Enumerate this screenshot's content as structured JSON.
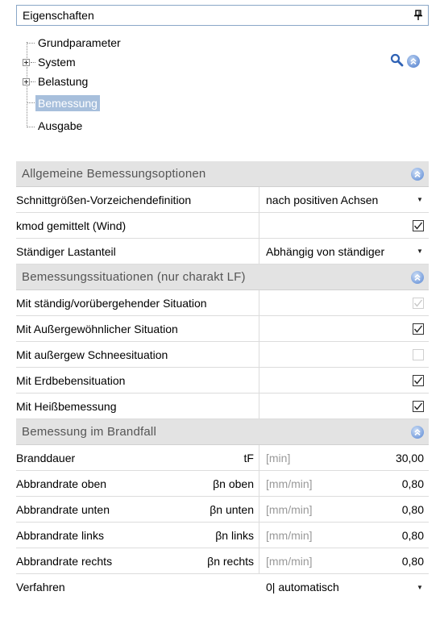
{
  "panel": {
    "title": "Eigenschaften",
    "pin_icon": "pin-icon"
  },
  "tree": {
    "items": [
      {
        "label": "Grundparameter",
        "expandable": false,
        "selected": false
      },
      {
        "label": "System",
        "expandable": true,
        "selected": false
      },
      {
        "label": "Belastung",
        "expandable": true,
        "selected": false
      },
      {
        "label": "Bemessung",
        "expandable": false,
        "selected": true
      },
      {
        "label": "Ausgabe",
        "expandable": false,
        "selected": false
      }
    ],
    "tools": {
      "search_icon": "search-icon",
      "collapse_icon": "collapse-all-icon"
    }
  },
  "colors": {
    "accent": "#6b93d6",
    "selection": "#a7bfdc",
    "category_bg": "#e3e3e3",
    "border": "#8aa7c7",
    "unit_gray": "#999999"
  },
  "grid": {
    "cat1": {
      "title": "Allgemeine Bemessungsoptionen",
      "rows": [
        {
          "name": "Schnittgrößen-Vorzeichendefinition",
          "value": "nach positiven Achsen"
        },
        {
          "name": "kmod gemittelt (Wind)",
          "checked": true
        },
        {
          "name": "Ständiger Lastanteil",
          "value": "Abhängig von ständiger"
        }
      ]
    },
    "cat2": {
      "title": "Bemessungssituationen (nur charakt LF)",
      "rows": [
        {
          "name": "Mit ständig/vorübergehender Situation",
          "checked": true,
          "disabled": true
        },
        {
          "name": "Mit Außergewöhnlicher Situation",
          "checked": true
        },
        {
          "name": "Mit außergew Schneesituation",
          "checked": false,
          "disabled": true
        },
        {
          "name": "Mit Erdbebensituation",
          "checked": true
        },
        {
          "name": "Mit Heißbemessung",
          "checked": true
        }
      ]
    },
    "cat3": {
      "title": "Bemessung im Brandfall",
      "rows": [
        {
          "name": "Branddauer",
          "symbol": "tF",
          "unit": "[min]",
          "value": "30,00"
        },
        {
          "name": "Abbrandrate oben",
          "symbol": "βn oben",
          "unit": "[mm/min]",
          "value": "0,80"
        },
        {
          "name": "Abbrandrate unten",
          "symbol": "βn unten",
          "unit": "[mm/min]",
          "value": "0,80"
        },
        {
          "name": "Abbrandrate links",
          "symbol": "βn links",
          "unit": "[mm/min]",
          "value": "0,80"
        },
        {
          "name": "Abbrandrate rechts",
          "symbol": "βn rechts",
          "unit": "[mm/min]",
          "value": "0,80"
        },
        {
          "name": "Verfahren",
          "value": "0| automatisch"
        }
      ]
    }
  }
}
